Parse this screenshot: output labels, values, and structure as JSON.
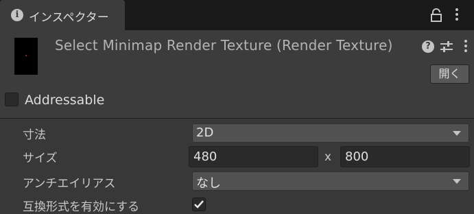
{
  "tab": {
    "title": "インスペクター",
    "icon": "info-icon"
  },
  "asset": {
    "title": "Select Minimap Render Texture (Render Texture)",
    "open_label": "開く"
  },
  "addressable": {
    "label": "Addressable",
    "checked": false
  },
  "properties": {
    "dimension": {
      "label": "寸法",
      "value": "2D"
    },
    "size": {
      "label": "サイズ",
      "width": "480",
      "x_label": "x",
      "height": "800"
    },
    "antialias": {
      "label": "アンチエイリアス",
      "value": "なし"
    },
    "compat": {
      "label": "互換形式を有効にする",
      "checked": true
    }
  },
  "colors": {
    "background": "#383838",
    "tab_bar": "#191919",
    "field": "#2a2a2a",
    "dropdown": "#515151"
  }
}
